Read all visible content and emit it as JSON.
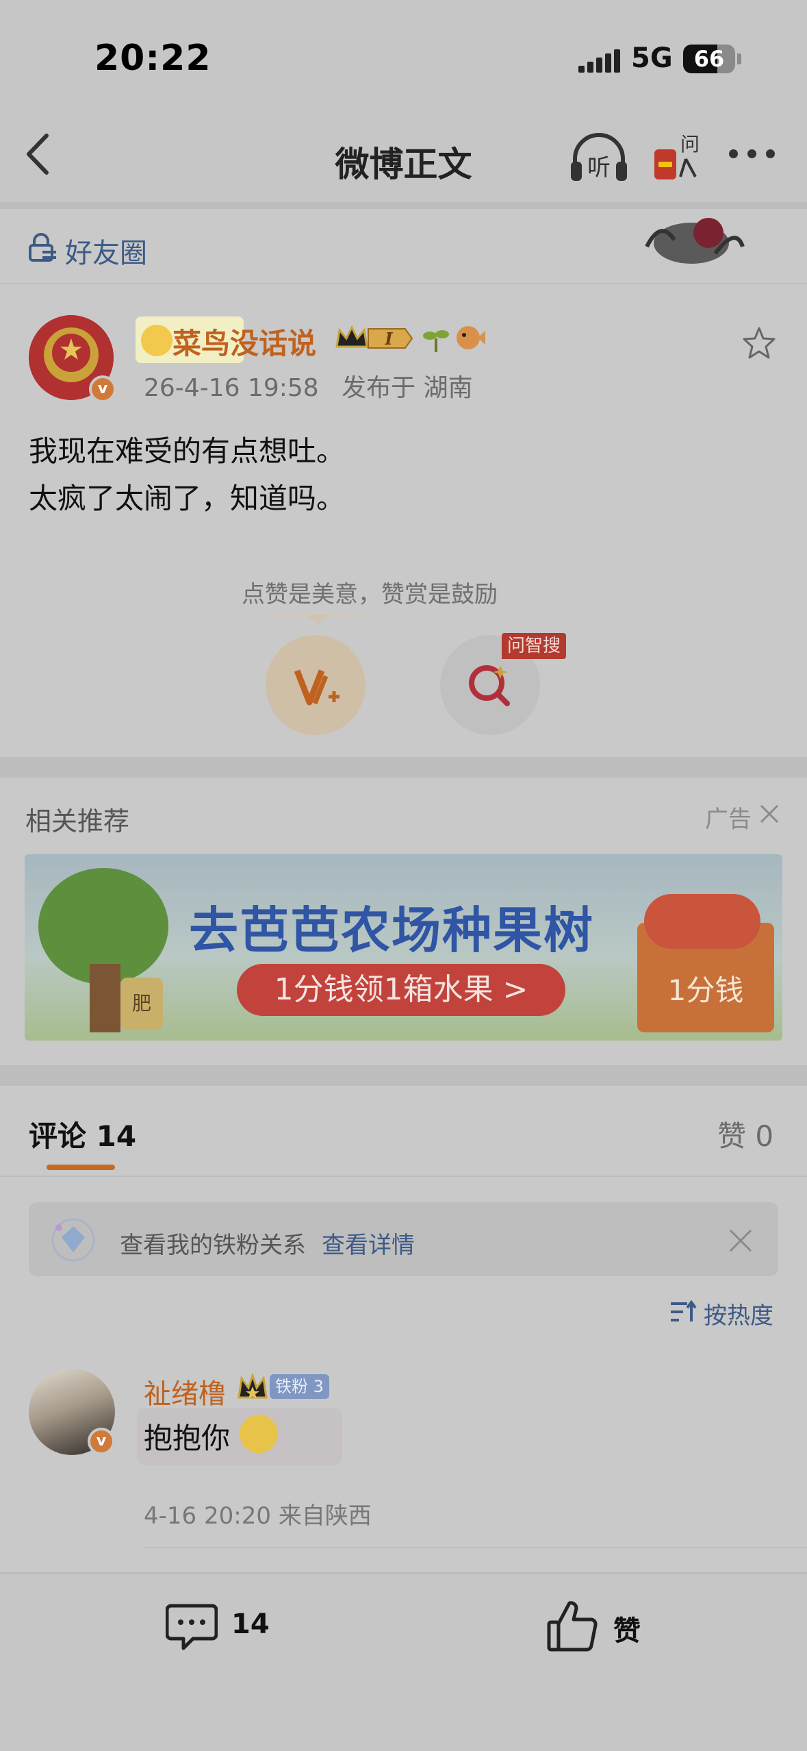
{
  "status_bar": {
    "time": "20:22",
    "network": "5G",
    "battery": "66",
    "battery_level": 0.66
  },
  "nav": {
    "title": "微博正文",
    "listen_label": "听",
    "ask_label": "问"
  },
  "friend_circle": {
    "label": "好友圈"
  },
  "post": {
    "author": "菜鸟没话说",
    "level_badge": "I",
    "date": "26-4-16 19:58",
    "location": "发布于 湖南",
    "lines": [
      "我现在难受的有点想吐。",
      "太疯了太闹了，知道吗。"
    ],
    "reward_hint": "点赞是美意，赞赏是鼓励",
    "search_badge": "问智搜",
    "verified_mark": "v"
  },
  "recommend": {
    "title": "相关推荐",
    "ad_label": "广告",
    "ad": {
      "headline": "去芭芭农场种果树",
      "pill": "1分钱领1箱水果 >",
      "box_label": "1分钱",
      "jar_label": "肥"
    }
  },
  "comments": {
    "tab_label": "评论 14",
    "likes_tab": "赞 0",
    "ironfan_text": "查看我的铁粉关系",
    "ironfan_link": "查看详情",
    "sort_label": "按热度",
    "items": [
      {
        "user": "祉绪橹",
        "fan_badge": "铁粉 3",
        "text": "抱抱你",
        "meta": "4-16 20:20 来自陕西",
        "verified_mark": "v"
      }
    ]
  },
  "bottom_bar": {
    "comment_count": "14",
    "like_label": "赞"
  },
  "colors": {
    "accent_orange": "#c0621f",
    "link_blue": "#3d5a86",
    "background": "#c9c9c9"
  },
  "icons": [
    "back-icon",
    "listen-icon",
    "ask-icon",
    "more-icon",
    "lock-icon",
    "star-icon",
    "reward-icon",
    "search-icon",
    "close-icon",
    "sort-icon",
    "comment-icon",
    "like-icon"
  ]
}
